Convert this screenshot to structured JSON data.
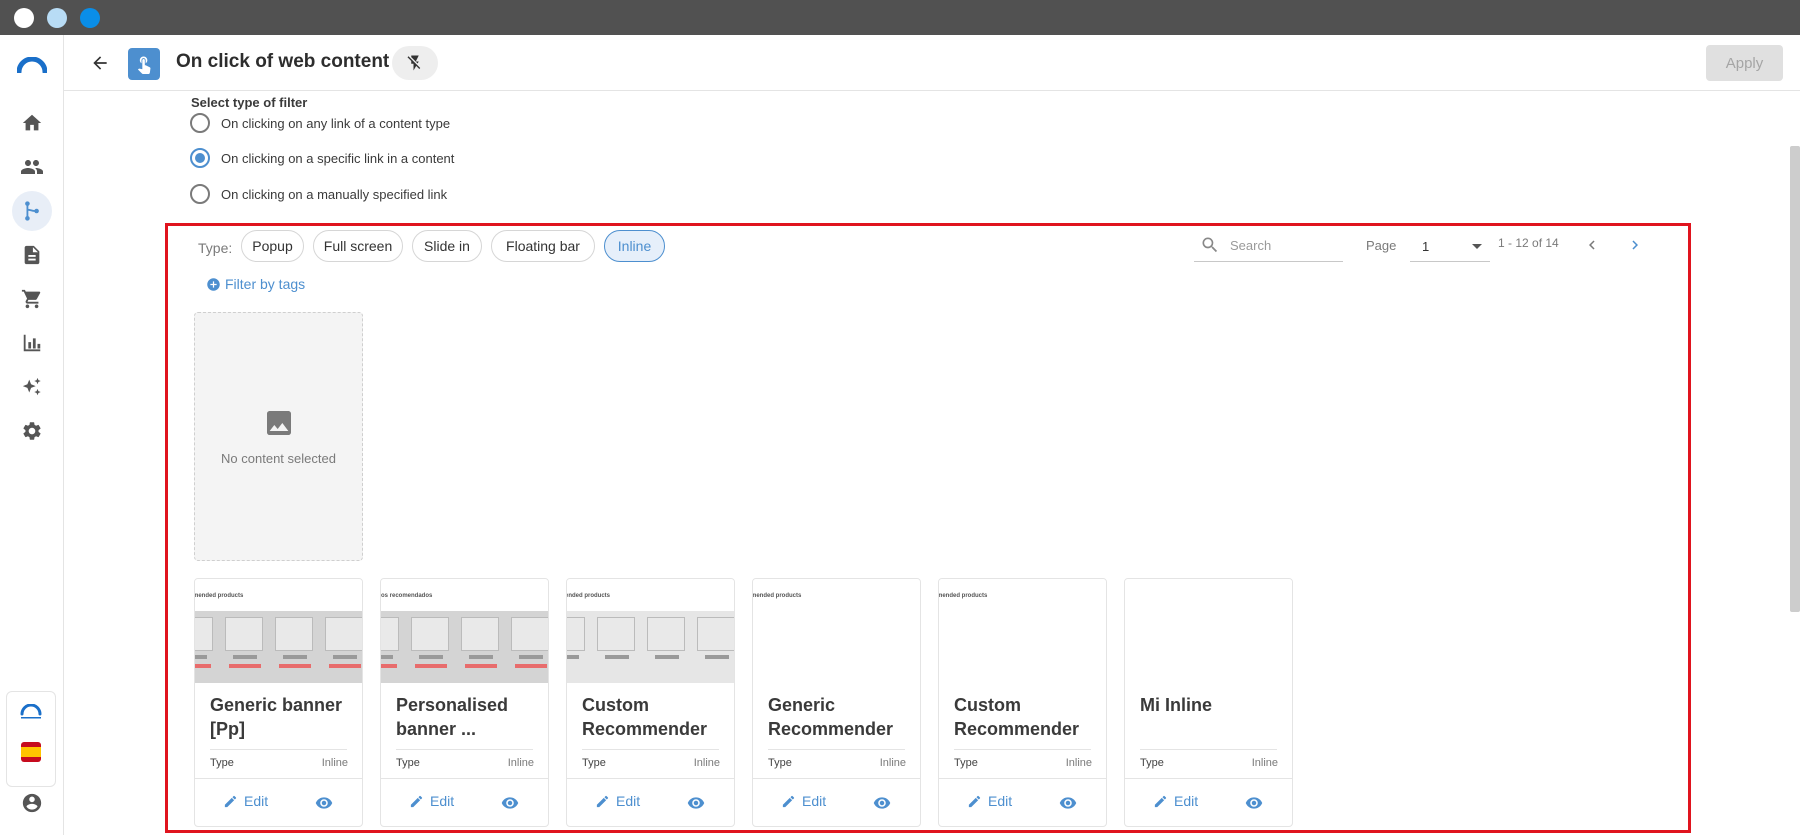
{
  "window": {
    "dots": [
      "#ffffff",
      "#b8dcf5",
      "#0a8ee8"
    ]
  },
  "sidebar": {
    "items": [
      {
        "icon": "home-icon"
      },
      {
        "icon": "people-icon"
      },
      {
        "icon": "journey-icon",
        "active": true
      },
      {
        "icon": "document-icon"
      },
      {
        "icon": "cart-icon"
      },
      {
        "icon": "bar-chart-icon"
      },
      {
        "icon": "sparkle-icon"
      },
      {
        "icon": "gear-icon"
      }
    ],
    "flag": "es"
  },
  "header": {
    "title": "On click of web content",
    "apply_label": "Apply"
  },
  "filter": {
    "label": "Select type of filter",
    "options": [
      {
        "label": "On clicking on any link of a content type",
        "checked": false
      },
      {
        "label": "On clicking on a specific link in a content",
        "checked": true
      },
      {
        "label": "On clicking on a manually specified link",
        "checked": false
      }
    ]
  },
  "toolbar": {
    "type_label": "Type:",
    "chips": [
      {
        "label": "Popup",
        "active": false
      },
      {
        "label": "Full screen",
        "active": false
      },
      {
        "label": "Slide in",
        "active": false
      },
      {
        "label": "Floating bar",
        "active": false
      },
      {
        "label": "Inline",
        "active": true
      }
    ],
    "search_placeholder": "Search",
    "page_label": "Page",
    "page_value": "1",
    "range_text": "1 - 12 of 14",
    "filter_tags_label": "Filter by tags"
  },
  "empty_card": {
    "label": "No content selected"
  },
  "cards": [
    {
      "title": "Generic banner [Pp]",
      "caption": "mended products",
      "thumb": "banner",
      "type_label": "Type",
      "type_value": "Inline",
      "edit_label": "Edit"
    },
    {
      "title": "Personalised banner ...",
      "caption": "tos recomendados",
      "thumb": "banner",
      "type_label": "Type",
      "type_value": "Inline",
      "edit_label": "Edit"
    },
    {
      "title": "Custom Recommender",
      "caption": "ended products",
      "thumb": "light",
      "type_label": "Type",
      "type_value": "Inline",
      "edit_label": "Edit"
    },
    {
      "title": "Generic Recommender",
      "caption": "mended products",
      "thumb": "blank",
      "type_label": "Type",
      "type_value": "Inline",
      "edit_label": "Edit"
    },
    {
      "title": "Custom Recommender",
      "caption": "mended products",
      "thumb": "blank",
      "type_label": "Type",
      "type_value": "Inline",
      "edit_label": "Edit"
    },
    {
      "title": "Mi Inline",
      "caption": "",
      "thumb": "blank",
      "type_label": "Type",
      "type_value": "Inline",
      "edit_label": "Edit"
    }
  ],
  "colors": {
    "accent": "#4d8fcf",
    "highlight_border": "#e0141e",
    "titlebar": "#515151"
  }
}
